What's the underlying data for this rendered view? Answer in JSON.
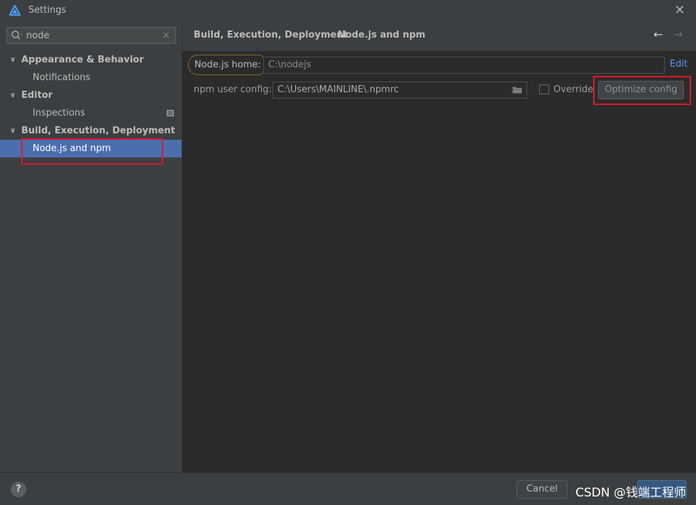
{
  "window": {
    "title": "Settings",
    "close_label": "✕"
  },
  "search": {
    "value": "node",
    "clear_label": "×"
  },
  "tree": {
    "items": [
      {
        "label": "Appearance & Behavior"
      },
      {
        "label": "Notifications"
      },
      {
        "label": "Editor"
      },
      {
        "label": "Inspections"
      },
      {
        "label": "Build, Execution, Deployment"
      },
      {
        "label": "Node.js and npm"
      }
    ]
  },
  "breadcrumb": {
    "parent": "Build, Execution, Deployment",
    "separator": "›",
    "current": "Node.js and npm",
    "back": "←",
    "forward": "→"
  },
  "form": {
    "node_home_label": "Node.js home:",
    "node_home_value": "C:\\nodejs",
    "edit_label": "Edit",
    "npm_config_label": "npm user config:",
    "npm_config_value": "C:\\Users\\MAINLINE\\.npmrc",
    "override_label": "Override",
    "optimize_label": "Optimize config"
  },
  "footer": {
    "help_label": "?",
    "cancel_label": "Cancel",
    "watermark": "CSDN @钱端工程师"
  },
  "colors": {
    "accent": "#4b6eaf",
    "highlight": "#e0182b",
    "link": "#589df6"
  }
}
